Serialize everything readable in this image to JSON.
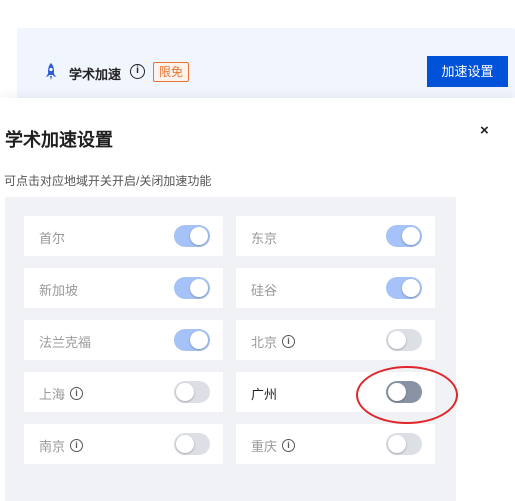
{
  "banner": {
    "title": "学术加速",
    "info_glyph": "i",
    "badge": "限免",
    "button_label": "加速设置",
    "rocket_icon": "rocket-icon"
  },
  "dialog": {
    "title": "学术加速设置",
    "close_glyph": "×",
    "description": "可点击对应地域开关开启/关闭加速功能"
  },
  "regions": [
    {
      "name": "首尔",
      "enabled": true,
      "info": false
    },
    {
      "name": "东京",
      "enabled": true,
      "info": false
    },
    {
      "name": "新加坡",
      "enabled": true,
      "info": false
    },
    {
      "name": "硅谷",
      "enabled": true,
      "info": false
    },
    {
      "name": "法兰克福",
      "enabled": true,
      "info": false
    },
    {
      "name": "北京",
      "enabled": false,
      "info": true
    },
    {
      "name": "上海",
      "enabled": false,
      "info": true
    },
    {
      "name": "广州",
      "enabled": false,
      "info": false,
      "highlighted": true
    },
    {
      "name": "南京",
      "enabled": false,
      "info": true
    },
    {
      "name": "重庆",
      "enabled": false,
      "info": true
    }
  ],
  "colors": {
    "accent": "#0052d9",
    "toggle_on": "#a5c3f8",
    "toggle_off": "#dcdfe6",
    "badge": "#e8742e",
    "highlight": "#e0262b"
  }
}
